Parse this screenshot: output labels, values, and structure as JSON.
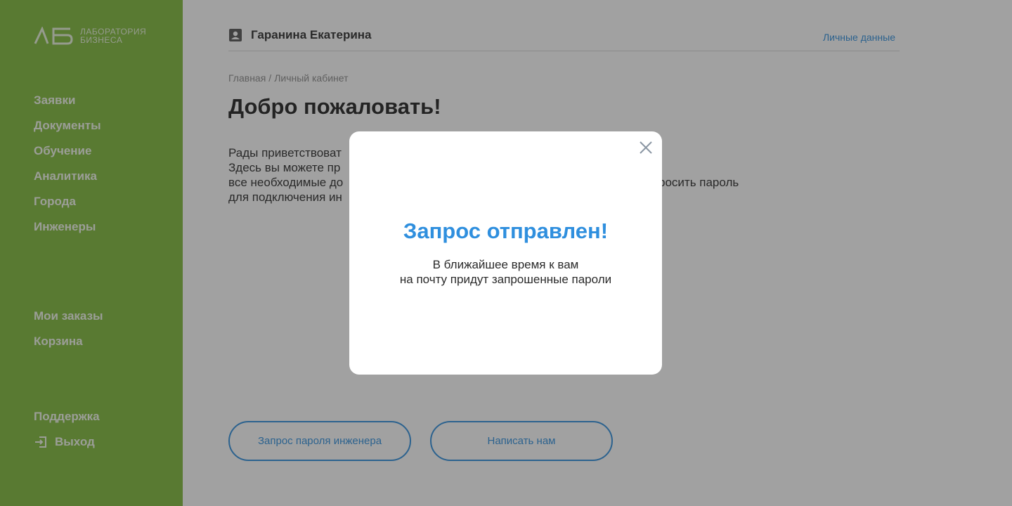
{
  "colors": {
    "sidebar_green": "#7fb93a",
    "accent_blue": "#2f8fde",
    "overlay": "rgba(40,40,40,0.44)"
  },
  "sidebar": {
    "logo": {
      "mark": "ЛБ",
      "line1": "ЛАБОРАТОРИЯ",
      "line2": "БИЗНЕСА"
    },
    "main_items": [
      {
        "label": "Заявки"
      },
      {
        "label": "Документы"
      },
      {
        "label": "Обучение"
      },
      {
        "label": "Аналитика"
      },
      {
        "label": "Города"
      },
      {
        "label": "Инженеры"
      }
    ],
    "order_items": [
      {
        "label": "Мои заказы"
      },
      {
        "label": "Корзина"
      }
    ],
    "support_label": "Поддержка",
    "exit": {
      "label": "Выход",
      "icon": "exit-icon"
    }
  },
  "header": {
    "user_icon": "user-card-icon",
    "user_name": "Гаранина Екатерина",
    "personal_link": "Личные данные"
  },
  "breadcrumb": {
    "home": "Главная",
    "separator": "/",
    "current": "Личный кабинет"
  },
  "page_title": "Добро пожаловать!",
  "intro_lines": [
    "Рады приветствоват",
    "Здесь вы можете пр",
    "все необходимые до",
    "для подключения ин"
  ],
  "intro_tail": "росить пароль",
  "buttons": {
    "engineer_password": "Запрос пароля инженера",
    "write_us": "Написать нам"
  },
  "modal": {
    "title": "Запрос отправлен!",
    "line1": "В ближайшее время к вам",
    "line2": "на почту придут запрошенные пароли",
    "close_icon": "close-icon"
  }
}
